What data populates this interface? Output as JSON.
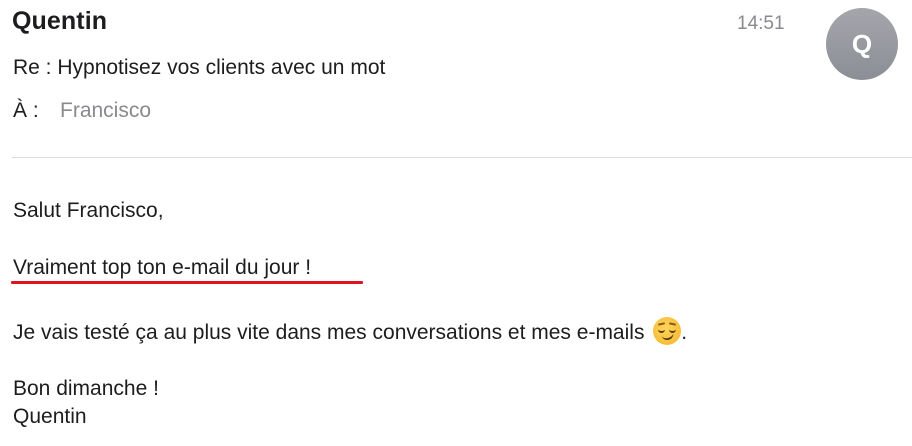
{
  "header": {
    "sender": "Quentin",
    "time": "14:51",
    "avatar_initial": "Q",
    "subject": "Re : Hypnotisez vos clients avec un mot",
    "to_label": "À :",
    "to_name": "Francisco"
  },
  "body": {
    "greeting": "Salut Francisco,",
    "line_highlighted": "Vraiment top ton e-mail du jour !",
    "line_main": "Je vais testé ça au plus vite dans mes conversations et mes e-mails",
    "line_main_end": ".",
    "emoji_icon": "smirking-face-emoji",
    "closing": "Bon dimanche !",
    "signature": "Quentin"
  },
  "colors": {
    "underline": "#e0141e",
    "avatar": "#9a9ca2",
    "muted_text": "#8a8a8e"
  }
}
